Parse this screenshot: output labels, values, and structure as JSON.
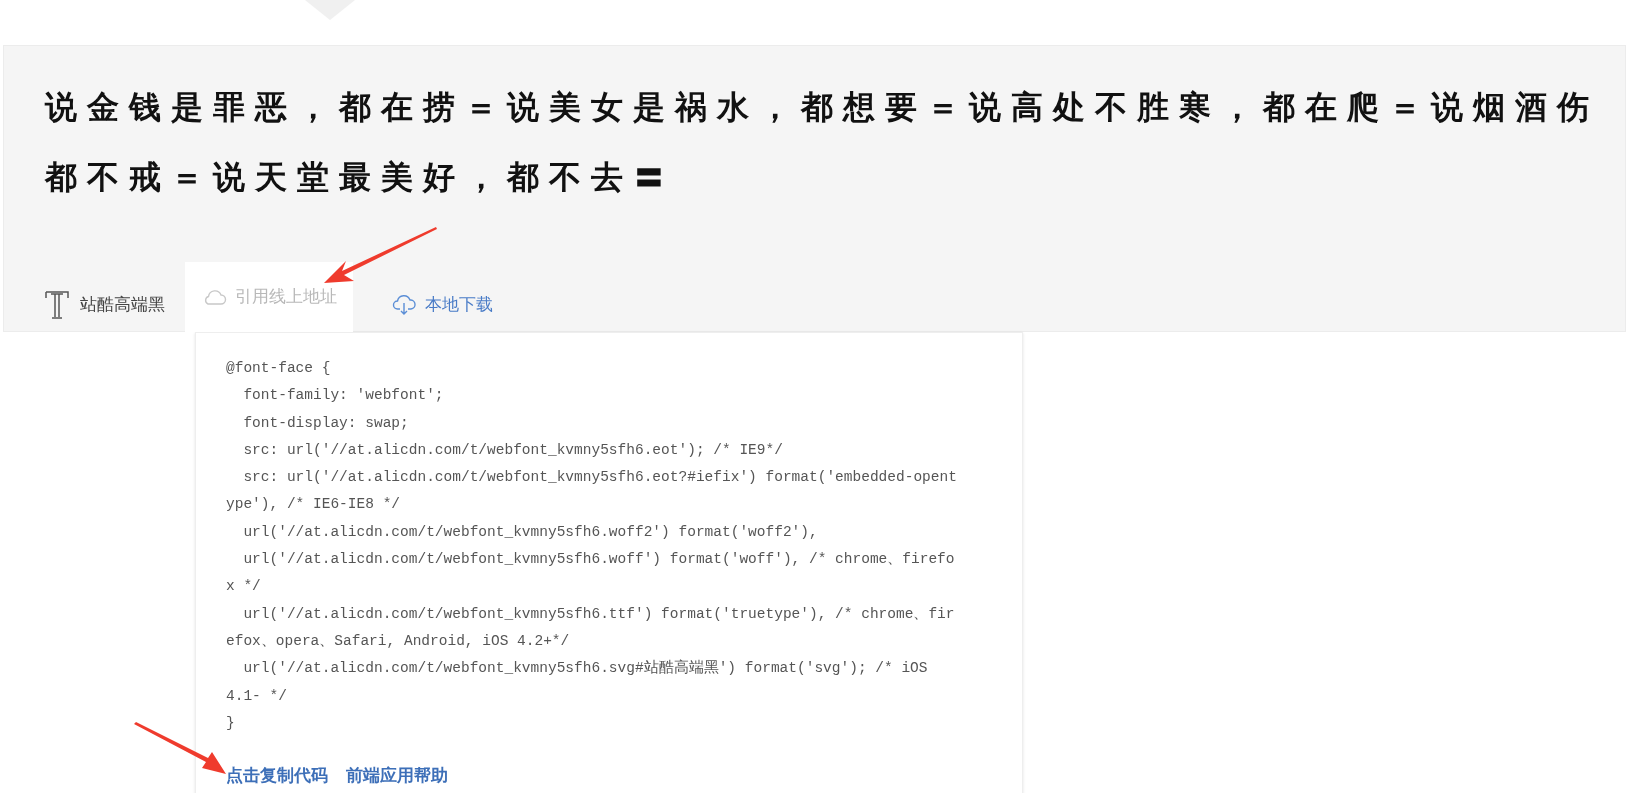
{
  "preview": {
    "lines": [
      "说金钱是罪恶，都在捞＝说美女是祸水，都想要＝说高处不胜寒，都在爬＝说烟酒伤",
      "都不戒＝说天堂最美好，都不去〓"
    ]
  },
  "font_name": "站酷高端黑",
  "tabs": [
    {
      "label": "引用线上地址",
      "kind": "cloud",
      "selected": true
    },
    {
      "label": "本地下载",
      "kind": "download",
      "selected": false
    }
  ],
  "code": {
    "lines": [
      "@font-face {",
      "  font-family: 'webfont';",
      "  font-display: swap;",
      "  src: url('//at.alicdn.com/t/webfont_kvmny5sfh6.eot'); /* IE9*/",
      "  src: url('//at.alicdn.com/t/webfont_kvmny5sfh6.eot?#iefix') format('embedded-opent",
      "ype'), /* IE6-IE8 */",
      "  url('//at.alicdn.com/t/webfont_kvmny5sfh6.woff2') format('woff2'),",
      "  url('//at.alicdn.com/t/webfont_kvmny5sfh6.woff') format('woff'), /* chrome、firefo",
      "x */",
      "  url('//at.alicdn.com/t/webfont_kvmny5sfh6.ttf') format('truetype'), /* chrome、fir",
      "efox、opera、Safari, Android, iOS 4.2+*/",
      "  url('//at.alicdn.com/t/webfont_kvmny5sfh6.svg#站酷高端黑') format('svg'); /* iOS",
      "4.1- */",
      "}"
    ]
  },
  "links": [
    "点击复制代码",
    "前端应用帮助"
  ]
}
